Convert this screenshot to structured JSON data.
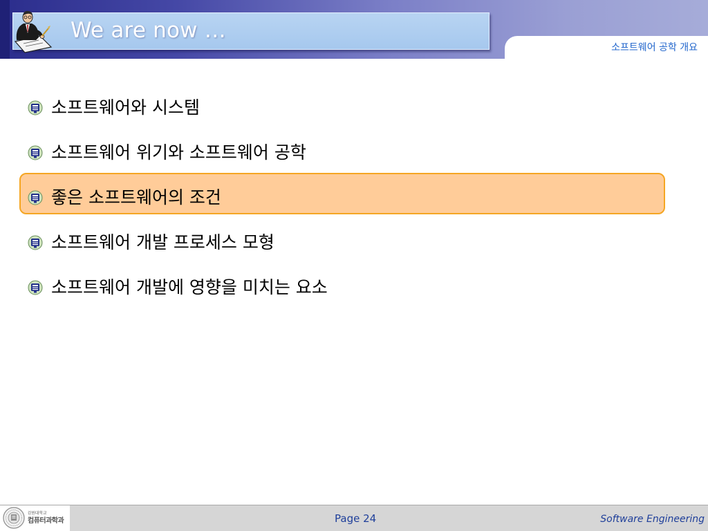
{
  "slide": {
    "title": "We are now …",
    "subtitle": "소프트웨어 공학 개요"
  },
  "agenda": {
    "items": [
      {
        "label": "소프트웨어와 시스템",
        "highlighted": false
      },
      {
        "label": "소프트웨어 위기와 소프트웨어 공학",
        "highlighted": false
      },
      {
        "label": "좋은 소프트웨어의 조건",
        "highlighted": true
      },
      {
        "label": "소프트웨어 개발 프로세스 모형",
        "highlighted": false
      },
      {
        "label": "소프트웨어 개발에 영향을 미치는 요소",
        "highlighted": false
      }
    ],
    "bullet_icon": "university-emblem-icon",
    "highlight_fill": "#ffcc99",
    "highlight_border": "#f5a623"
  },
  "footer": {
    "school": "강원대학교",
    "department": "컴퓨터과학과",
    "page_label": "Page 24",
    "course": "Software Engineering",
    "seal_icon": "university-seal-icon"
  },
  "colors": {
    "header_dark": "#2b2d8c",
    "header_light": "#a6acd9",
    "title_box": "#a6c8ee",
    "subtitle_text": "#2266cc",
    "footer_text": "#1f3f9a"
  },
  "header": {
    "icon": "presenter-writing-icon"
  }
}
